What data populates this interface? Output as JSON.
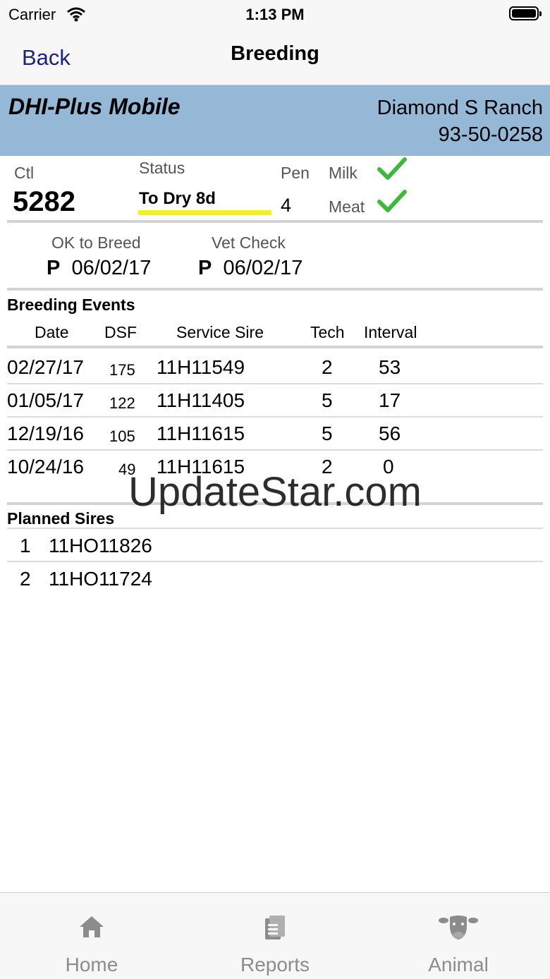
{
  "status_bar": {
    "carrier": "Carrier",
    "time": "1:13 PM"
  },
  "nav": {
    "back_label": "Back",
    "title": "Breeding"
  },
  "header": {
    "app_name": "DHI-Plus Mobile",
    "ranch_name": "Diamond S Ranch",
    "herd_id": "93-50-0258",
    "color": "#94b8d6"
  },
  "animal": {
    "ctl_label": "Ctl",
    "ctl_value": "5282",
    "status_label": "Status",
    "status_value": "To Dry 8d",
    "pen_label": "Pen",
    "pen_value": "4",
    "milk_label": "Milk",
    "meat_label": "Meat",
    "milk_ok": true,
    "meat_ok": true
  },
  "breed_status": {
    "ok_to_breed_label": "OK to Breed",
    "ok_to_breed_code": "P",
    "ok_to_breed_date": "06/02/17",
    "vet_check_label": "Vet Check",
    "vet_check_code": "P",
    "vet_check_date": "06/02/17"
  },
  "breeding_events": {
    "title": "Breeding Events",
    "columns": [
      "Date",
      "DSF",
      "Service Sire",
      "Tech",
      "Interval"
    ],
    "rows": [
      {
        "date": "02/27/17",
        "dsf": "175",
        "sire": "11H11549",
        "tech": "2",
        "interval": "53"
      },
      {
        "date": "01/05/17",
        "dsf": "122",
        "sire": "11H11405",
        "tech": "5",
        "interval": "17"
      },
      {
        "date": "12/19/16",
        "dsf": "105",
        "sire": "11H11615",
        "tech": "5",
        "interval": "56"
      },
      {
        "date": "10/24/16",
        "dsf": "49",
        "sire": "11H11615",
        "tech": "2",
        "interval": "0"
      }
    ]
  },
  "planned_sires": {
    "title": "Planned Sires",
    "items": [
      {
        "num": "1",
        "sire": "11HO11826"
      },
      {
        "num": "2",
        "sire": "11HO11724"
      }
    ]
  },
  "watermark": "UpdateStar.com",
  "tabs": [
    {
      "label": "Home",
      "icon": "home-icon"
    },
    {
      "label": "Reports",
      "icon": "reports-icon"
    },
    {
      "label": "Animal",
      "icon": "cow-icon"
    }
  ],
  "colors": {
    "check": "#3db83d",
    "highlight": "#f3f31a",
    "back": "#1a237e",
    "tab_inactive": "#8c8c8c"
  }
}
